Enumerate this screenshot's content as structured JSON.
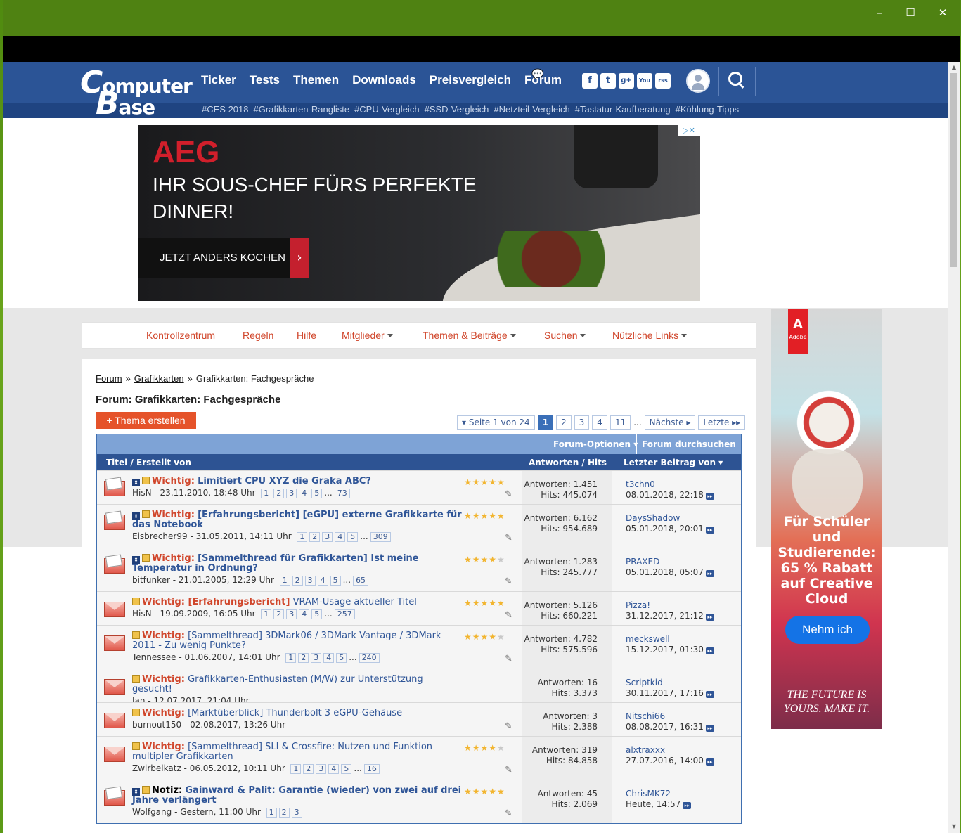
{
  "site": {
    "logo_line1": "omputer",
    "logo_line2": "ase",
    "logo_c": "C",
    "logo_b": "B",
    "nav": [
      "Ticker",
      "Tests",
      "Themen",
      "Downloads",
      "Preisvergleich",
      "Forum"
    ],
    "tags": [
      "#CES 2018",
      "#Grafikkarten-Rangliste",
      "#CPU-Vergleich",
      "#SSD-Vergleich",
      "#Netzteil-Vergleich",
      "#Tastatur-Kaufberatung",
      "#Kühlung-Tipps"
    ],
    "social": [
      "f",
      "t",
      "g+",
      "You",
      "rss"
    ]
  },
  "ad": {
    "brand": "AEG",
    "headline": "IHR SOUS-CHEF FÜRS PERFEKTE DINNER!",
    "cta": "JETZT ANDERS KOCHEN",
    "cta_arrow": "›",
    "adchoice": "▷✕"
  },
  "sidead": {
    "brand": "Adobe",
    "promo": "Für Schüler und Studierende: 65 % Rabatt auf Creative Cloud",
    "button": "Nehm ich",
    "tagline": "THE FUTURE IS YOURS. MAKE IT."
  },
  "forumnav": [
    "Kontrollzentrum",
    "Regeln",
    "Hilfe",
    "Mitglieder",
    "Themen & Beiträge",
    "Suchen",
    "Nützliche Links"
  ],
  "breadcrumb": {
    "forum": "Forum",
    "sep": "»",
    "parent": "Grafikkarten",
    "current": "Grafikkarten: Fachgespräche"
  },
  "page_title": "Forum: Grafikkarten: Fachgespräche",
  "new_thread": "+ Thema erstellen",
  "pager": {
    "label": "▾ Seite 1 von 24",
    "pages": [
      "1",
      "2",
      "3",
      "4",
      "11"
    ],
    "dots": "...",
    "next": "Nächste ▸",
    "last": "Letzte ▸▸"
  },
  "table": {
    "options": "Forum-Optionen ▾",
    "search": "Forum durchsuchen ▾",
    "col_title": "Titel / Erstellt von",
    "col_stats": "Antworten / Hits",
    "col_last": "Letzter Beitrag von ▾"
  },
  "threads": [
    {
      "prefix": "Wichtig:",
      "title": "Limitiert CPU XYZ die Graka ABC?",
      "bold": true,
      "author": "HisN - 23.11.2010, 18:48 Uhr",
      "pages": [
        "1",
        "2",
        "3",
        "4",
        "5"
      ],
      "lastpage": "73",
      "replies": "Antworten: 1.451",
      "hits": "Hits: 445.074",
      "lastuser": "t3chn0",
      "lastdate": "08.01.2018, 22:18",
      "stars": 5,
      "clip": true,
      "sticky": true
    },
    {
      "prefix": "Wichtig:",
      "title": "[Erfahrungsbericht] [eGPU] externe Grafikkarte für das Notebook",
      "bold": true,
      "author": "Eisbrecher99 - 31.05.2011, 14:11 Uhr",
      "pages": [
        "1",
        "2",
        "3",
        "4",
        "5"
      ],
      "lastpage": "309",
      "replies": "Antworten: 6.162",
      "hits": "Hits: 954.689",
      "lastuser": "DaysShadow",
      "lastdate": "05.01.2018, 20:01",
      "stars": 5,
      "clip": true,
      "sticky": true
    },
    {
      "prefix": "Wichtig:",
      "title": "[Sammelthread für Grafikkarten] Ist meine Temperatur in Ordnung?",
      "bold": true,
      "author": "bitfunker - 21.01.2005, 12:29 Uhr",
      "pages": [
        "1",
        "2",
        "3",
        "4",
        "5"
      ],
      "lastpage": "65",
      "replies": "Antworten: 1.283",
      "hits": "Hits: 245.777",
      "lastuser": "PRAXED",
      "lastdate": "05.01.2018, 05:07",
      "stars": 4,
      "clip": true,
      "sticky": true
    },
    {
      "prefix": "Wichtig: [Erfahrungsbericht]",
      "title": "VRAM-Usage aktueller Titel",
      "bold": false,
      "author": "HisN - 19.09.2009, 16:05 Uhr",
      "pages": [
        "1",
        "2",
        "3",
        "4",
        "5"
      ],
      "lastpage": "257",
      "replies": "Antworten: 5.126",
      "hits": "Hits: 660.221",
      "lastuser": "Pizza!",
      "lastdate": "31.12.2017, 21:12",
      "stars": 5,
      "clip": true,
      "sticky": false
    },
    {
      "prefix": "Wichtig:",
      "title": "[Sammelthread] 3DMark06 / 3DMark Vantage / 3DMark 2011 - Zu wenig Punkte?",
      "bold": false,
      "author": "Tennessee - 01.06.2007, 14:01 Uhr",
      "pages": [
        "1",
        "2",
        "3",
        "4",
        "5"
      ],
      "lastpage": "240",
      "replies": "Antworten: 4.782",
      "hits": "Hits: 575.596",
      "lastuser": "meckswell",
      "lastdate": "15.12.2017, 01:30",
      "stars": 4,
      "clip": true,
      "sticky": false
    },
    {
      "prefix": "Wichtig:",
      "title": "Grafikkarten-Enthusiasten (M/W) zur Unterstützung gesucht!",
      "bold": false,
      "author": "Jan - 12.07.2017, 21:04 Uhr",
      "pages": [],
      "lastpage": "",
      "replies": "Antworten: 16",
      "hits": "Hits: 3.373",
      "lastuser": "Scriptkid",
      "lastdate": "30.11.2017, 17:16",
      "stars": 0,
      "clip": false,
      "sticky": false
    },
    {
      "prefix": "Wichtig:",
      "title": "[Marktüberblick] Thunderbolt 3 eGPU-Gehäuse",
      "bold": false,
      "author": "burnout150 - 02.08.2017, 13:26 Uhr",
      "pages": [],
      "lastpage": "",
      "replies": "Antworten: 3",
      "hits": "Hits: 2.388",
      "lastuser": "Nitschi66",
      "lastdate": "08.08.2017, 16:31",
      "stars": 0,
      "clip": true,
      "sticky": false
    },
    {
      "prefix": "Wichtig:",
      "title": "[Sammelthread] SLI & Crossfire: Nutzen und Funktion multipler Grafikkarten",
      "bold": false,
      "author": "Zwirbelkatz - 06.05.2012, 10:11 Uhr",
      "pages": [
        "1",
        "2",
        "3",
        "4",
        "5"
      ],
      "lastpage": "16",
      "replies": "Antworten: 319",
      "hits": "Hits: 84.858",
      "lastuser": "alxtraxxx",
      "lastdate": "27.07.2016, 14:00",
      "stars": 4,
      "clip": true,
      "sticky": false
    },
    {
      "prefix": "Notiz:",
      "title": "Gainward & Palit: Garantie (wieder) von zwei auf drei Jahre verlängert",
      "bold": true,
      "author": "Wolfgang - Gestern, 11:00 Uhr",
      "pages": [
        "1",
        "2",
        "3"
      ],
      "lastpage": "",
      "replies": "Antworten: 45",
      "hits": "Hits: 2.069",
      "lastuser": "ChrisMK72",
      "lastdate": "Heute, 14:57",
      "stars": 5,
      "clip": true,
      "sticky": true,
      "notiz": true
    }
  ]
}
